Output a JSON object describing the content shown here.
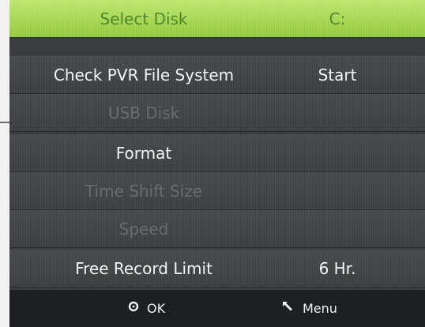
{
  "menu": {
    "items": [
      {
        "label": "Select Disk",
        "value": "C:",
        "state": "selected"
      },
      {
        "label": "Check PVR File System",
        "value": "Start",
        "state": "enabled"
      },
      {
        "label": "USB Disk",
        "value": "",
        "state": "disabled"
      },
      {
        "label": "Format",
        "value": "",
        "state": "enabled"
      },
      {
        "label": "Time Shift Size",
        "value": "",
        "state": "disabled"
      },
      {
        "label": "Speed",
        "value": "",
        "state": "disabled"
      },
      {
        "label": "Free Record Limit",
        "value": "6 Hr.",
        "state": "enabled"
      }
    ]
  },
  "footer": {
    "ok_label": "OK",
    "ok_icon": "circle-ok-icon",
    "menu_label": "Menu",
    "menu_icon": "return-arrow-icon"
  },
  "colors": {
    "selected_bg": "#a8d95a",
    "selected_text": "#4d8a2a",
    "row_bg": "#444547",
    "enabled_text": "#f4f4f4",
    "disabled_text": "#6a6b6d",
    "footer_bg": "#1e1f21"
  }
}
